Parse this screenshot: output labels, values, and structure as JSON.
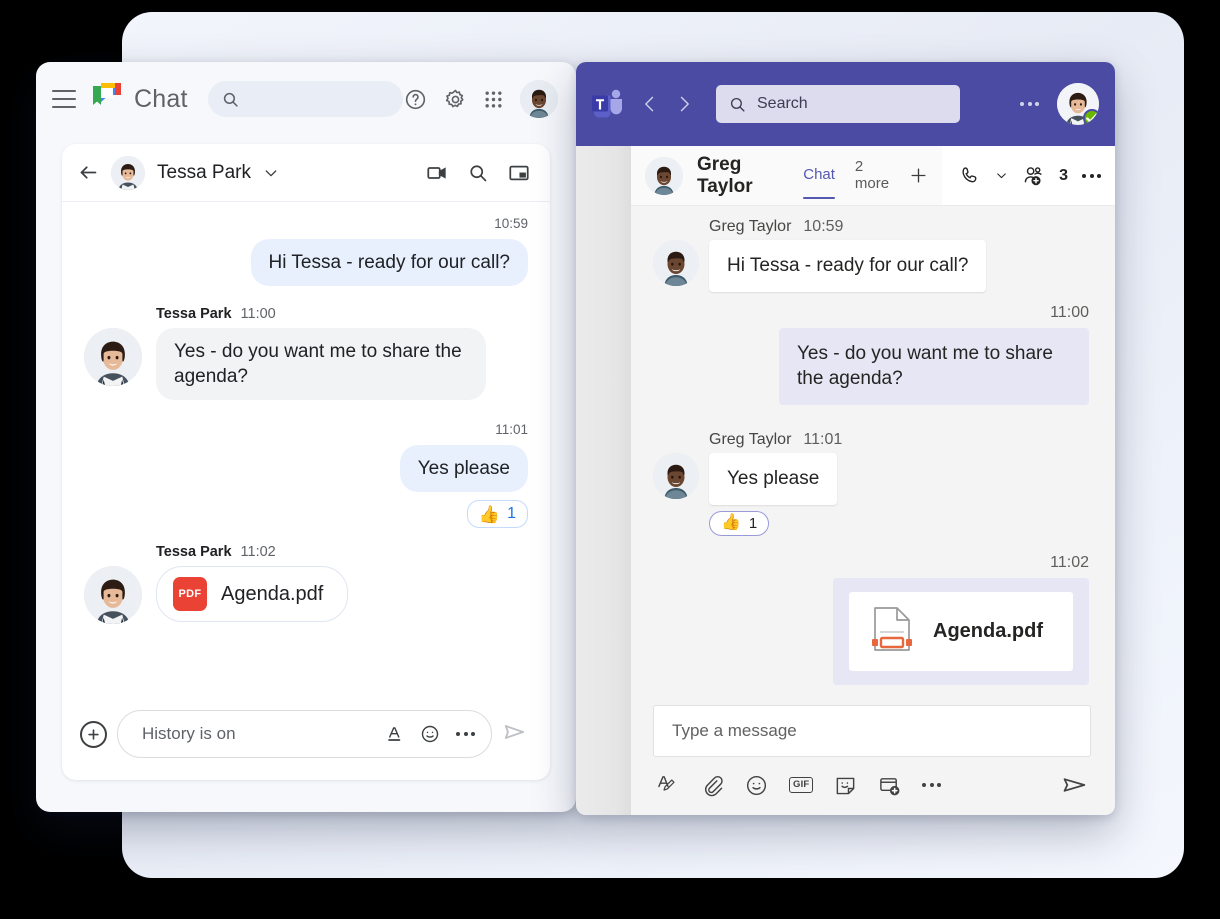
{
  "google_chat": {
    "brand": "Chat",
    "search_placeholder": "",
    "icons": {
      "menu": "hamburger-icon",
      "logo": "google-chat-logo",
      "search": "search-icon",
      "help": "help-icon",
      "settings": "gear-icon",
      "apps": "apps-grid-icon",
      "account": "account-avatar"
    },
    "conversation": {
      "title": "Tessa Park",
      "back": "back-arrow-icon",
      "chevron": "chevron-down-icon",
      "actions": [
        "video-call-icon",
        "search-icon",
        "picture-in-picture-icon"
      ]
    },
    "messages": [
      {
        "id": "m1",
        "direction": "outgoing",
        "time": "10:59",
        "text": "Hi Tessa - ready for our call?"
      },
      {
        "id": "m2",
        "direction": "incoming",
        "sender": "Tessa Park",
        "time": "11:00",
        "text": "Yes - do you want me to share the agenda?"
      },
      {
        "id": "m3",
        "direction": "outgoing",
        "time": "11:01",
        "text": "Yes please",
        "reaction": {
          "emoji": "👍",
          "count": "1"
        }
      },
      {
        "id": "m4",
        "direction": "incoming",
        "sender": "Tessa Park",
        "time": "11:02",
        "file": {
          "name": "Agenda.pdf",
          "badge": "PDF",
          "badge_color": "#ea4335"
        }
      }
    ],
    "composer": {
      "plus": "plus-icon",
      "placeholder": "History is on",
      "format_icon": "text-format-icon",
      "emoji_icon": "emoji-icon",
      "more_icon": "more-options-icon",
      "send_icon": "send-icon"
    }
  },
  "teams": {
    "logo": "microsoft-teams-logo",
    "nav": {
      "back": "back-chevron-icon",
      "forward": "forward-chevron-icon"
    },
    "search_placeholder": "Search",
    "more_icon": "more-options-icon",
    "account": "account-avatar",
    "presence": "available-status",
    "chat_header": {
      "title": "Greg Taylor",
      "tabs": [
        {
          "label": "Chat",
          "active": true
        },
        {
          "label": "2 more",
          "active": false
        }
      ],
      "add_tab": "add-tab-icon",
      "call_icon": "call-icon",
      "call_chevron": "chevron-down-icon",
      "people_icon": "add-people-icon",
      "people_count": "3",
      "overflow_icon": "more-options-icon"
    },
    "messages": [
      {
        "id": "t1",
        "direction": "incoming",
        "sender": "Greg Taylor",
        "time": "10:59",
        "text": "Hi Tessa - ready for our call?"
      },
      {
        "id": "t2",
        "direction": "outgoing",
        "time": "11:00",
        "text": "Yes - do you want me to share the agenda?"
      },
      {
        "id": "t3",
        "direction": "incoming",
        "sender": "Greg Taylor",
        "time": "11:01",
        "text": "Yes please",
        "reaction": {
          "emoji": "👍",
          "count": "1"
        }
      },
      {
        "id": "t4",
        "direction": "outgoing",
        "time": "11:02",
        "file": {
          "name": "Agenda.pdf",
          "icon": "pdf-file-icon"
        }
      }
    ],
    "composer": {
      "placeholder": "Type a message",
      "tools": [
        "format-icon",
        "attach-icon",
        "emoji-icon",
        "giphy-icon",
        "sticker-icon",
        "meet-now-icon",
        "more-options-icon"
      ],
      "gif_label": "GIF",
      "send_icon": "send-icon"
    }
  },
  "colors": {
    "teams_purple": "#4b4ba3",
    "teams_accent": "#5558af",
    "gchat_blue_bubble": "#e8f0fe",
    "gchat_gray_bubble": "#f1f3f4",
    "teams_lavender_bubble": "#e6e6f5",
    "pdf_red": "#ea4335",
    "presence_green": "#6bb700",
    "gchat_link_blue": "#1a73e8"
  }
}
